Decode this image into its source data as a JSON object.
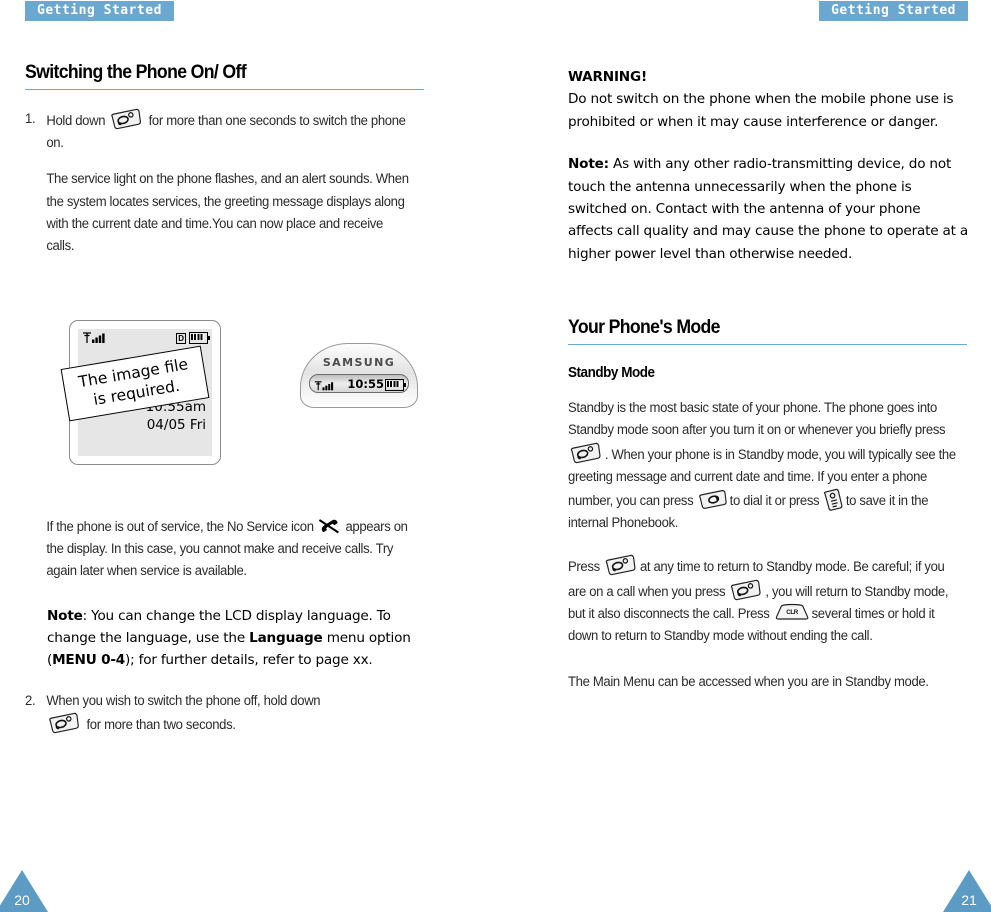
{
  "colors": {
    "accent": "#6ba7ce",
    "footer_triangle": "#5b9bc4",
    "rule": "#6ba7ce",
    "lcd_background": "#e6e6e6"
  },
  "left_page": {
    "header_tab": "Getting Started",
    "page_number": "20",
    "title": "Switching the Phone On/ Off",
    "step1": {
      "number": "1.",
      "text_before_key": "Hold down",
      "key_icon": "end-key-icon",
      "text_after_key": "for more than one seconds to switch the phone on."
    },
    "paragraph_service": "The service light on the phone flashes, and an alert sounds. When the system locates services, the greeting message displays along with the current date and time.You can now place and receive calls.",
    "figure": {
      "stamp_line1": "The image file",
      "stamp_line2": "is required.",
      "lcd_time": "10:55am",
      "lcd_date": "04/05 Fri",
      "status_d": "D",
      "signal_icon": "signal-bars-icon",
      "battery_icon": "battery-icon",
      "sub_display_brand": "SAMSUNG",
      "sub_display_time": "10:55"
    },
    "paragraph_noservice": {
      "before_icon": "If the phone is out of service, the No Service icon",
      "icon": "no-service-icon",
      "after_icon": "appears on the display. In this case, you cannot make and receive calls. Try again later when service is available."
    },
    "note_language": {
      "label": "Note",
      "part1": ": You can change the LCD display language. To change the language, use the ",
      "bold1": "Language",
      "part2": " menu option (",
      "bold2": "MENU 0-4",
      "part3": "); for further details, refer to page xx."
    },
    "step2": {
      "number": "2.",
      "text_before_key": "When you wish to switch the phone off, hold down",
      "key_icon": "end-key-icon",
      "text_after_key": "for more than two seconds."
    }
  },
  "right_page": {
    "header_tab": "Getting Started",
    "page_number": "21",
    "warning": {
      "label": "WARNING!",
      "text": "Do not switch on the phone when the mobile phone use is prohibited or when it may cause interference or danger."
    },
    "note_antenna": {
      "label": "Note:",
      "text": " As with any other radio-transmitting device, do not touch the antenna unnecessarily when the phone is switched on. Contact with the antenna of your phone affects call quality and may cause the phone to operate at a higher power level than otherwise needed."
    },
    "title": "Your Phone's Mode",
    "subtitle": "Standby Mode",
    "standby_paragraph": {
      "p1": "Standby is the most basic state of your phone. The phone goes into Standby mode soon after you turn it on or whenever you briefly press",
      "key1": "end-key-icon",
      "p2": ". When your phone is in Standby mode, you will typically see the greeting message and current date and time. If you enter a phone number, you can press",
      "key2": "send-key-icon",
      "p3": "to dial it or press",
      "key3": "phonebook-key-icon",
      "p4": "to save it in the internal Phonebook."
    },
    "press_paragraph": {
      "p1": "Press",
      "key1": "end-key-icon",
      "p2": "at any time to return to Standby mode. Be careful; if you are on a call when you press",
      "key2": "end-key-icon",
      "p3": ", you will return to Standby mode, but it also disconnects the call. Press",
      "key3": "clr-key-icon",
      "key3_label": "CLR",
      "p4": "several times or hold it down to return to Standby mode without ending the call."
    },
    "main_menu_paragraph": "The Main Menu can be accessed when you are in Standby mode."
  }
}
